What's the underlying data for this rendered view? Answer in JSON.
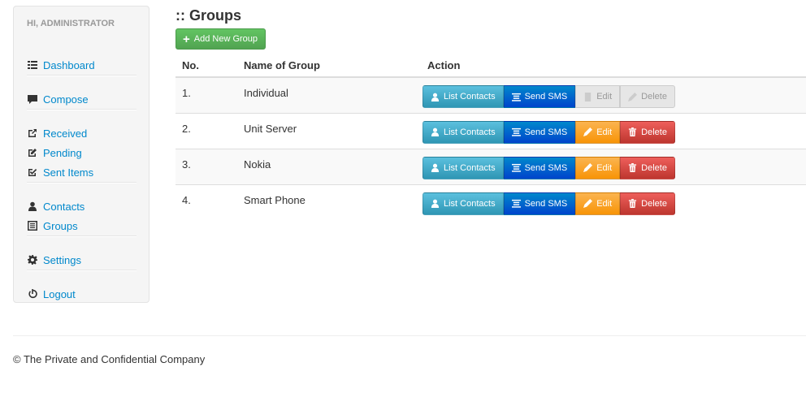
{
  "sidebar": {
    "greeting": "Hi, Administrator",
    "items": [
      {
        "label": "Dashboard",
        "icon": "list-icon"
      },
      {
        "label": "Compose",
        "icon": "comment-icon"
      },
      {
        "label": "Received",
        "icon": "share-icon"
      },
      {
        "label": "Pending",
        "icon": "edit-icon"
      },
      {
        "label": "Sent Items",
        "icon": "check-icon"
      },
      {
        "label": "Contacts",
        "icon": "user-icon"
      },
      {
        "label": "Groups",
        "icon": "list-alt-icon"
      },
      {
        "label": "Settings",
        "icon": "cog-icon"
      },
      {
        "label": "Logout",
        "icon": "power-icon"
      }
    ]
  },
  "main": {
    "title": ":: Groups",
    "add_button": "Add New Group",
    "table": {
      "headers": [
        "No.",
        "Name of Group",
        "Action"
      ],
      "rows": [
        {
          "no": "1.",
          "name": "Individual",
          "disabled": true
        },
        {
          "no": "2.",
          "name": "Unit Server",
          "disabled": false
        },
        {
          "no": "3.",
          "name": "Nokia",
          "disabled": false
        },
        {
          "no": "4.",
          "name": "Smart Phone",
          "disabled": false
        }
      ],
      "actions": {
        "list_contacts": "List Contacts",
        "send_sms": "Send SMS",
        "edit": "Edit",
        "delete": "Delete"
      }
    }
  },
  "footer": "© The Private and Confidential Company",
  "colors": {
    "link": "#0088cc",
    "success": "#51a351",
    "info": "#2f96b4",
    "primary": "#0044cc",
    "warning": "#f89406",
    "danger": "#bd362f"
  }
}
